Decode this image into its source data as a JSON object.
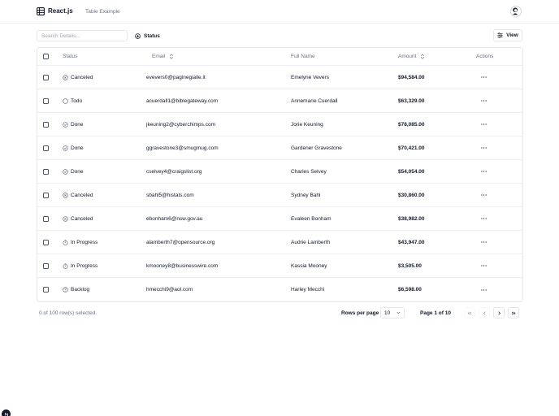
{
  "header": {
    "brand": "React.js",
    "nav_link": "Table Example",
    "icons": {
      "logo": "table-icon",
      "avatar": "user-avatar"
    }
  },
  "toolbar": {
    "search_placeholder": "Search Details...",
    "status_filter_label": "Status",
    "view_button_label": "View"
  },
  "table": {
    "columns": {
      "status": "Status",
      "email": "Email",
      "full_name": "Full Name",
      "amount": "Amount",
      "actions": "Actions"
    },
    "rows": [
      {
        "status": "Canceled",
        "status_icon": "circle-x-icon",
        "email": "evevers0@paginegialle.it",
        "full_name": "Emelyne Vevers",
        "amount": "$94,584.00"
      },
      {
        "status": "Todo",
        "status_icon": "circle-icon",
        "email": "acuerdall1@biblegateway.com",
        "full_name": "Annemarie Cuerdall",
        "amount": "$63,329.00"
      },
      {
        "status": "Done",
        "status_icon": "circle-check-icon",
        "email": "jkeuning2@cyberchimps.com",
        "full_name": "Jorie Keuning",
        "amount": "$78,085.00"
      },
      {
        "status": "Done",
        "status_icon": "circle-check-icon",
        "email": "ggravestone3@smugmug.com",
        "full_name": "Gardener Gravestone",
        "amount": "$70,421.00"
      },
      {
        "status": "Done",
        "status_icon": "circle-check-icon",
        "email": "cselvey4@craigslist.org",
        "full_name": "Charles Selvey",
        "amount": "$54,054.00"
      },
      {
        "status": "Canceled",
        "status_icon": "circle-x-icon",
        "email": "sbahl5@histats.com",
        "full_name": "Sydney Bahl",
        "amount": "$30,860.00"
      },
      {
        "status": "Canceled",
        "status_icon": "circle-x-icon",
        "email": "ebonham6@nsw.gov.au",
        "full_name": "Evaleen Bonham",
        "amount": "$38,982.00"
      },
      {
        "status": "In Progress",
        "status_icon": "timer-icon",
        "email": "alamberth7@opensource.org",
        "full_name": "Audrie Lamberth",
        "amount": "$43,947.00"
      },
      {
        "status": "In Progress",
        "status_icon": "timer-icon",
        "email": "kmooney8@businesswire.com",
        "full_name": "Kassia Mooney",
        "amount": "$3,505.00"
      },
      {
        "status": "Backlog",
        "status_icon": "help-circle-icon",
        "email": "hmecchi9@aol.com",
        "full_name": "Harley Mecchi",
        "amount": "$6,598.00"
      }
    ]
  },
  "footer": {
    "selection_text": "0 of 100 row(s) selected.",
    "rows_per_page_label": "Rows per page",
    "rows_per_page_value": "10",
    "page_text": "Page 1 of 10"
  },
  "colors": {
    "text": "#111827",
    "muted": "#6b7280",
    "border": "#e5e7eb"
  }
}
